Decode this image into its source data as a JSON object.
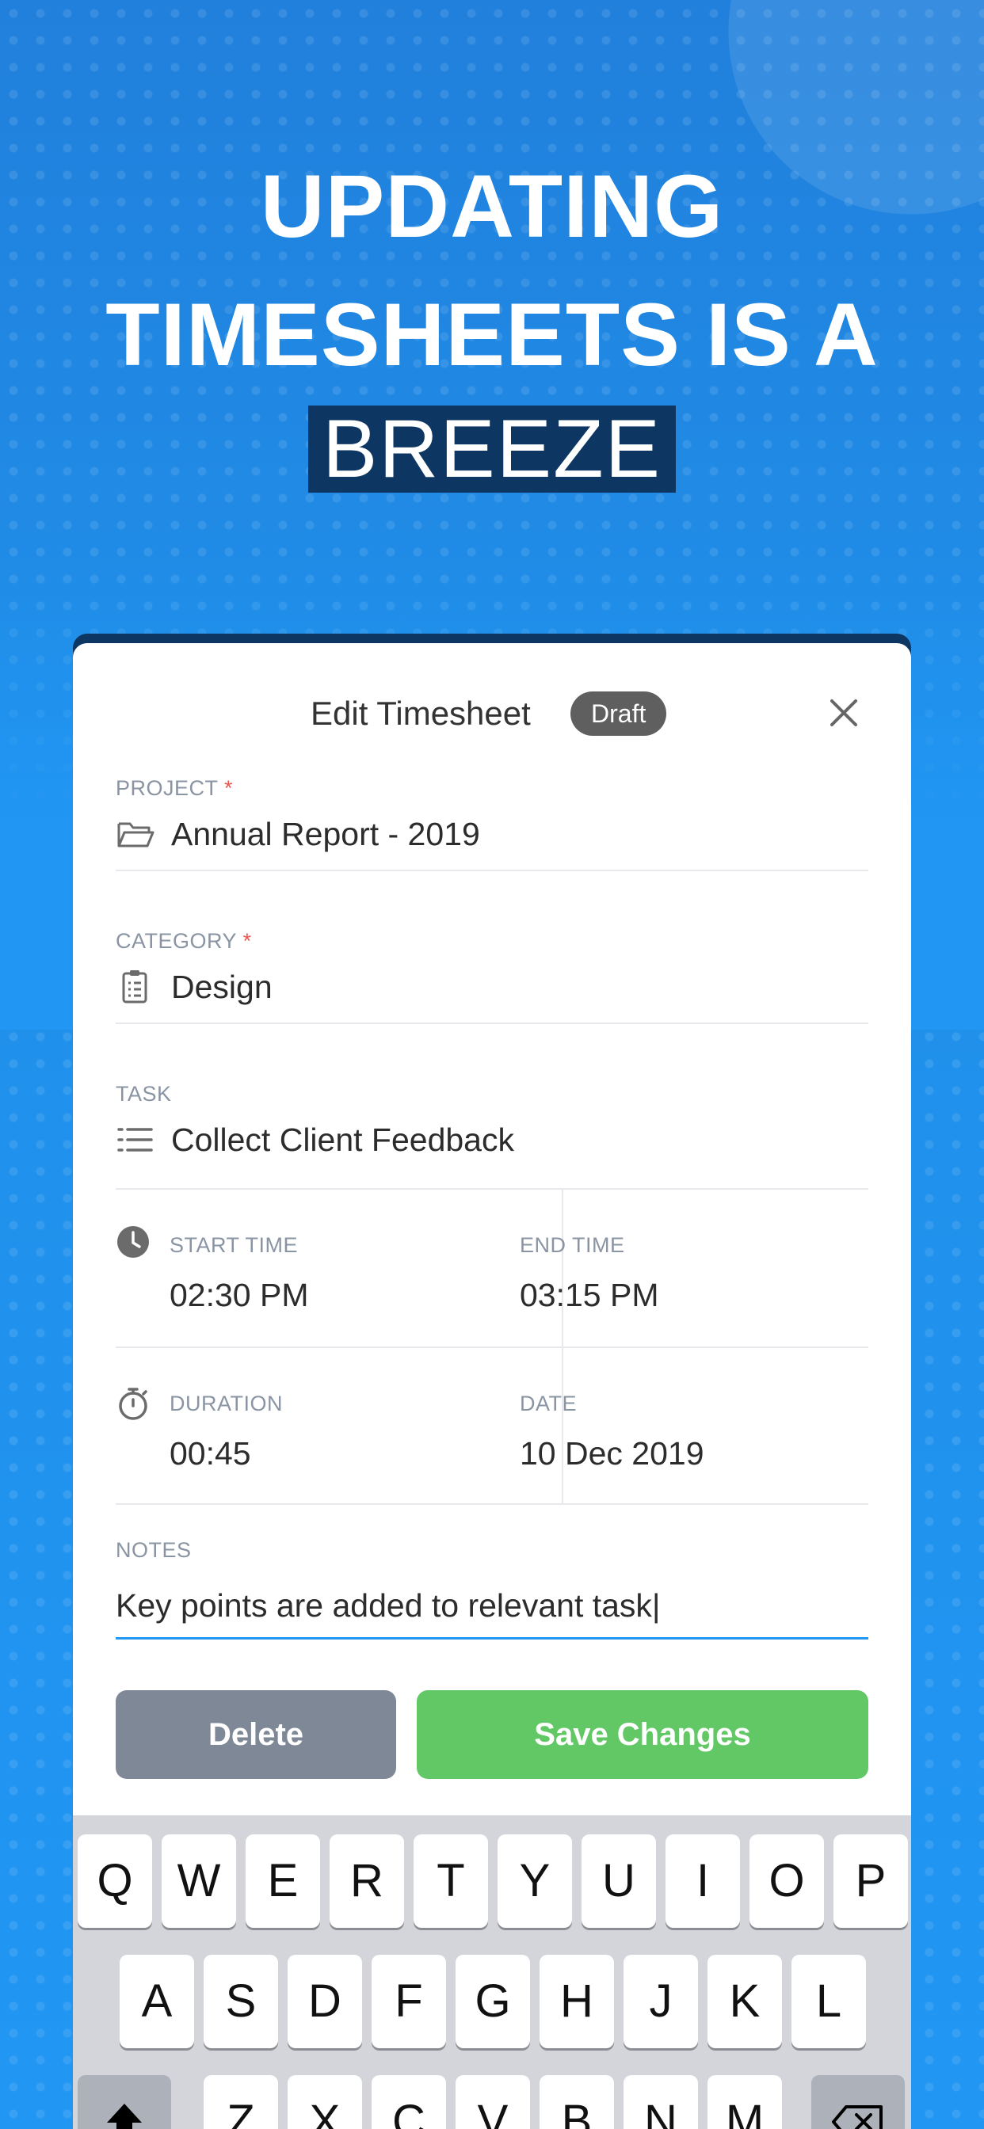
{
  "promo": {
    "headline_line1": "UPDATING",
    "headline_line2": "TIMESHEETS IS A",
    "highlight": "BREEZE"
  },
  "modal": {
    "title": "Edit Timesheet",
    "status": "Draft",
    "close_icon": "close-icon"
  },
  "fields": {
    "project": {
      "label": "PROJECT",
      "required_mark": "*",
      "value": "Annual Report - 2019",
      "icon": "folder-open-icon"
    },
    "category": {
      "label": "CATEGORY",
      "required_mark": "*",
      "value": "Design",
      "icon": "clipboard-list-icon"
    },
    "task": {
      "label": "TASK",
      "value": "Collect Client Feedback",
      "icon": "list-icon"
    },
    "start_time": {
      "label": "START TIME",
      "value": "02:30 PM",
      "icon": "clock-icon"
    },
    "end_time": {
      "label": "END TIME",
      "value": "03:15 PM"
    },
    "duration": {
      "label": "DURATION",
      "value": "00:45",
      "icon": "stopwatch-icon"
    },
    "date": {
      "label": "DATE",
      "value": "10 Dec 2019"
    },
    "notes": {
      "label": "NOTES",
      "value": "Key points are added to relevant task|"
    }
  },
  "buttons": {
    "delete": "Delete",
    "save": "Save Changes"
  },
  "keyboard": {
    "row1": [
      "Q",
      "W",
      "E",
      "R",
      "T",
      "Y",
      "U",
      "I",
      "O",
      "P"
    ],
    "row2": [
      "A",
      "S",
      "D",
      "F",
      "G",
      "H",
      "J",
      "K",
      "L"
    ],
    "row3": [
      "Z",
      "X",
      "C",
      "V",
      "B",
      "N",
      "M"
    ],
    "shift_icon": "shift-icon",
    "backspace_icon": "backspace-icon"
  },
  "colors": {
    "background": "#2196f3",
    "highlight_bg": "#0d3663",
    "pill": "#5f5f5f",
    "delete_button": "#7f8896",
    "save_button": "#61c865",
    "active_underline": "#2196f3",
    "required": "#e8574d"
  }
}
